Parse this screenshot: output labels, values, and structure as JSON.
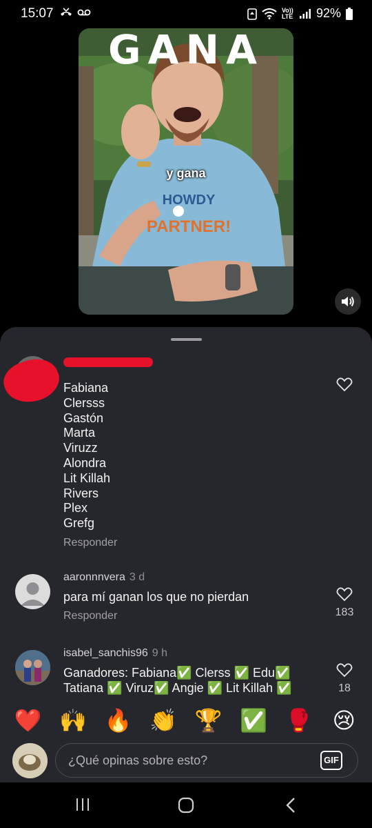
{
  "status": {
    "time": "15:07",
    "network_label": "Vo)) LTE",
    "battery": "92%"
  },
  "video": {
    "overlay_title": "GANA",
    "caption": "y gana",
    "shirt_text_1": "HOWDY",
    "shirt_text_2": "PARTNER!"
  },
  "comments": [
    {
      "username": "",
      "time": "",
      "lines": [
        "Fabiana",
        "Clersss",
        "Gastón",
        "Marta",
        "Viruzz",
        "Alondra",
        "Lit Killah",
        "Rivers",
        "Plex",
        "Grefg"
      ],
      "reply_label": "Responder",
      "likes": ""
    },
    {
      "username": "aaronnnvera",
      "time": "3 d",
      "text": "para mí ganan los que no pierdan",
      "reply_label": "Responder",
      "likes": "183"
    },
    {
      "username": "isabel_sanchis96",
      "time": "9 h",
      "text": "Ganadores: Fabiana✅ Clerss ✅ Edu✅ Tatiana ✅ Viruz✅ Angie ✅ Lit Killah ✅",
      "likes": "18"
    }
  ],
  "emoji_bar": [
    "❤️",
    "🙌",
    "🔥",
    "👏",
    "🏆",
    "✅",
    "🥊",
    "😢"
  ],
  "composer": {
    "placeholder": "¿Qué opinas sobre esto?",
    "gif_label": "GIF"
  },
  "colors": {
    "sheet_bg": "#26272c",
    "redaction": "#e8112b",
    "screen_bg": "#000000"
  }
}
